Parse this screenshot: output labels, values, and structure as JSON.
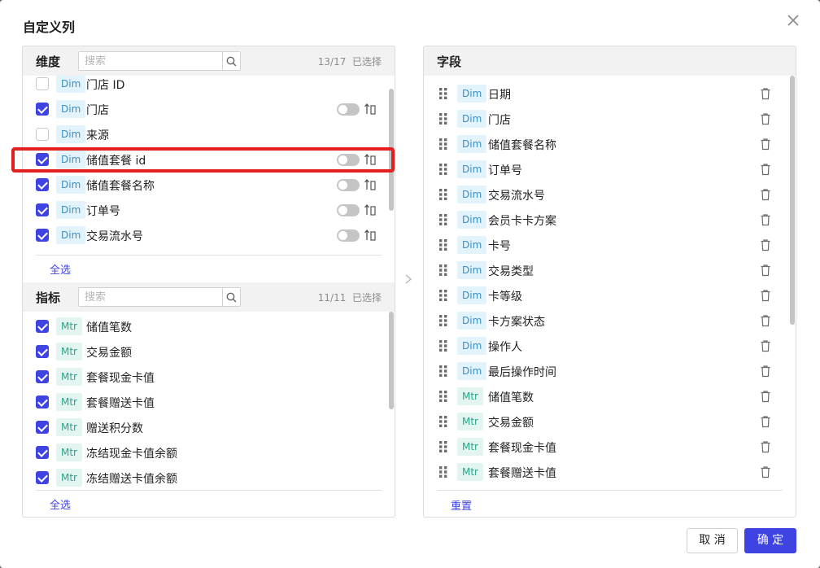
{
  "dialog": {
    "title": "自定义列",
    "confirm_label": "确 定",
    "cancel_label": "取 消"
  },
  "dimensions": {
    "title": "维度",
    "search_placeholder": "搜索",
    "count": "13/17",
    "selected_label": "已选择",
    "select_all_label": "全选",
    "items": [
      {
        "tag": "Dim",
        "label": "门店 ID",
        "checked": false,
        "has_toggle": false
      },
      {
        "tag": "Dim",
        "label": "门店",
        "checked": true,
        "has_toggle": true
      },
      {
        "tag": "Dim",
        "label": "来源",
        "checked": false,
        "has_toggle": false
      },
      {
        "tag": "Dim",
        "label": "储值套餐 id",
        "checked": true,
        "has_toggle": true
      },
      {
        "tag": "Dim",
        "label": "储值套餐名称",
        "checked": true,
        "has_toggle": true
      },
      {
        "tag": "Dim",
        "label": "订单号",
        "checked": true,
        "has_toggle": true
      },
      {
        "tag": "Dim",
        "label": "交易流水号",
        "checked": true,
        "has_toggle": true
      }
    ]
  },
  "metrics": {
    "title": "指标",
    "search_placeholder": "搜索",
    "count": "11/11",
    "selected_label": "已选择",
    "select_all_label": "全选",
    "items": [
      {
        "tag": "Mtr",
        "label": "储值笔数",
        "checked": true
      },
      {
        "tag": "Mtr",
        "label": "交易金额",
        "checked": true
      },
      {
        "tag": "Mtr",
        "label": "套餐现金卡值",
        "checked": true
      },
      {
        "tag": "Mtr",
        "label": "套餐赠送卡值",
        "checked": true
      },
      {
        "tag": "Mtr",
        "label": "赠送积分数",
        "checked": true
      },
      {
        "tag": "Mtr",
        "label": "冻结现金卡值余额",
        "checked": true
      },
      {
        "tag": "Mtr",
        "label": "冻结赠送卡值余额",
        "checked": true
      }
    ]
  },
  "fields": {
    "title": "字段",
    "reset_label": "重置",
    "items": [
      {
        "tag": "Dim",
        "label": "日期"
      },
      {
        "tag": "Dim",
        "label": "门店"
      },
      {
        "tag": "Dim",
        "label": "储值套餐名称"
      },
      {
        "tag": "Dim",
        "label": "订单号"
      },
      {
        "tag": "Dim",
        "label": "交易流水号"
      },
      {
        "tag": "Dim",
        "label": "会员卡卡方案"
      },
      {
        "tag": "Dim",
        "label": "卡号"
      },
      {
        "tag": "Dim",
        "label": "交易类型"
      },
      {
        "tag": "Dim",
        "label": "卡等级"
      },
      {
        "tag": "Dim",
        "label": "卡方案状态"
      },
      {
        "tag": "Dim",
        "label": "操作人"
      },
      {
        "tag": "Dim",
        "label": "最后操作时间"
      },
      {
        "tag": "Mtr",
        "label": "储值笔数"
      },
      {
        "tag": "Mtr",
        "label": "交易金额"
      },
      {
        "tag": "Mtr",
        "label": "套餐现金卡值"
      },
      {
        "tag": "Mtr",
        "label": "套餐赠送卡值"
      }
    ]
  },
  "colors": {
    "accent": "#3e43e2",
    "dim_tag_bg": "#e3f3fb",
    "mtr_tag_bg": "#e3f5f1",
    "highlight": "#e41f1f"
  }
}
